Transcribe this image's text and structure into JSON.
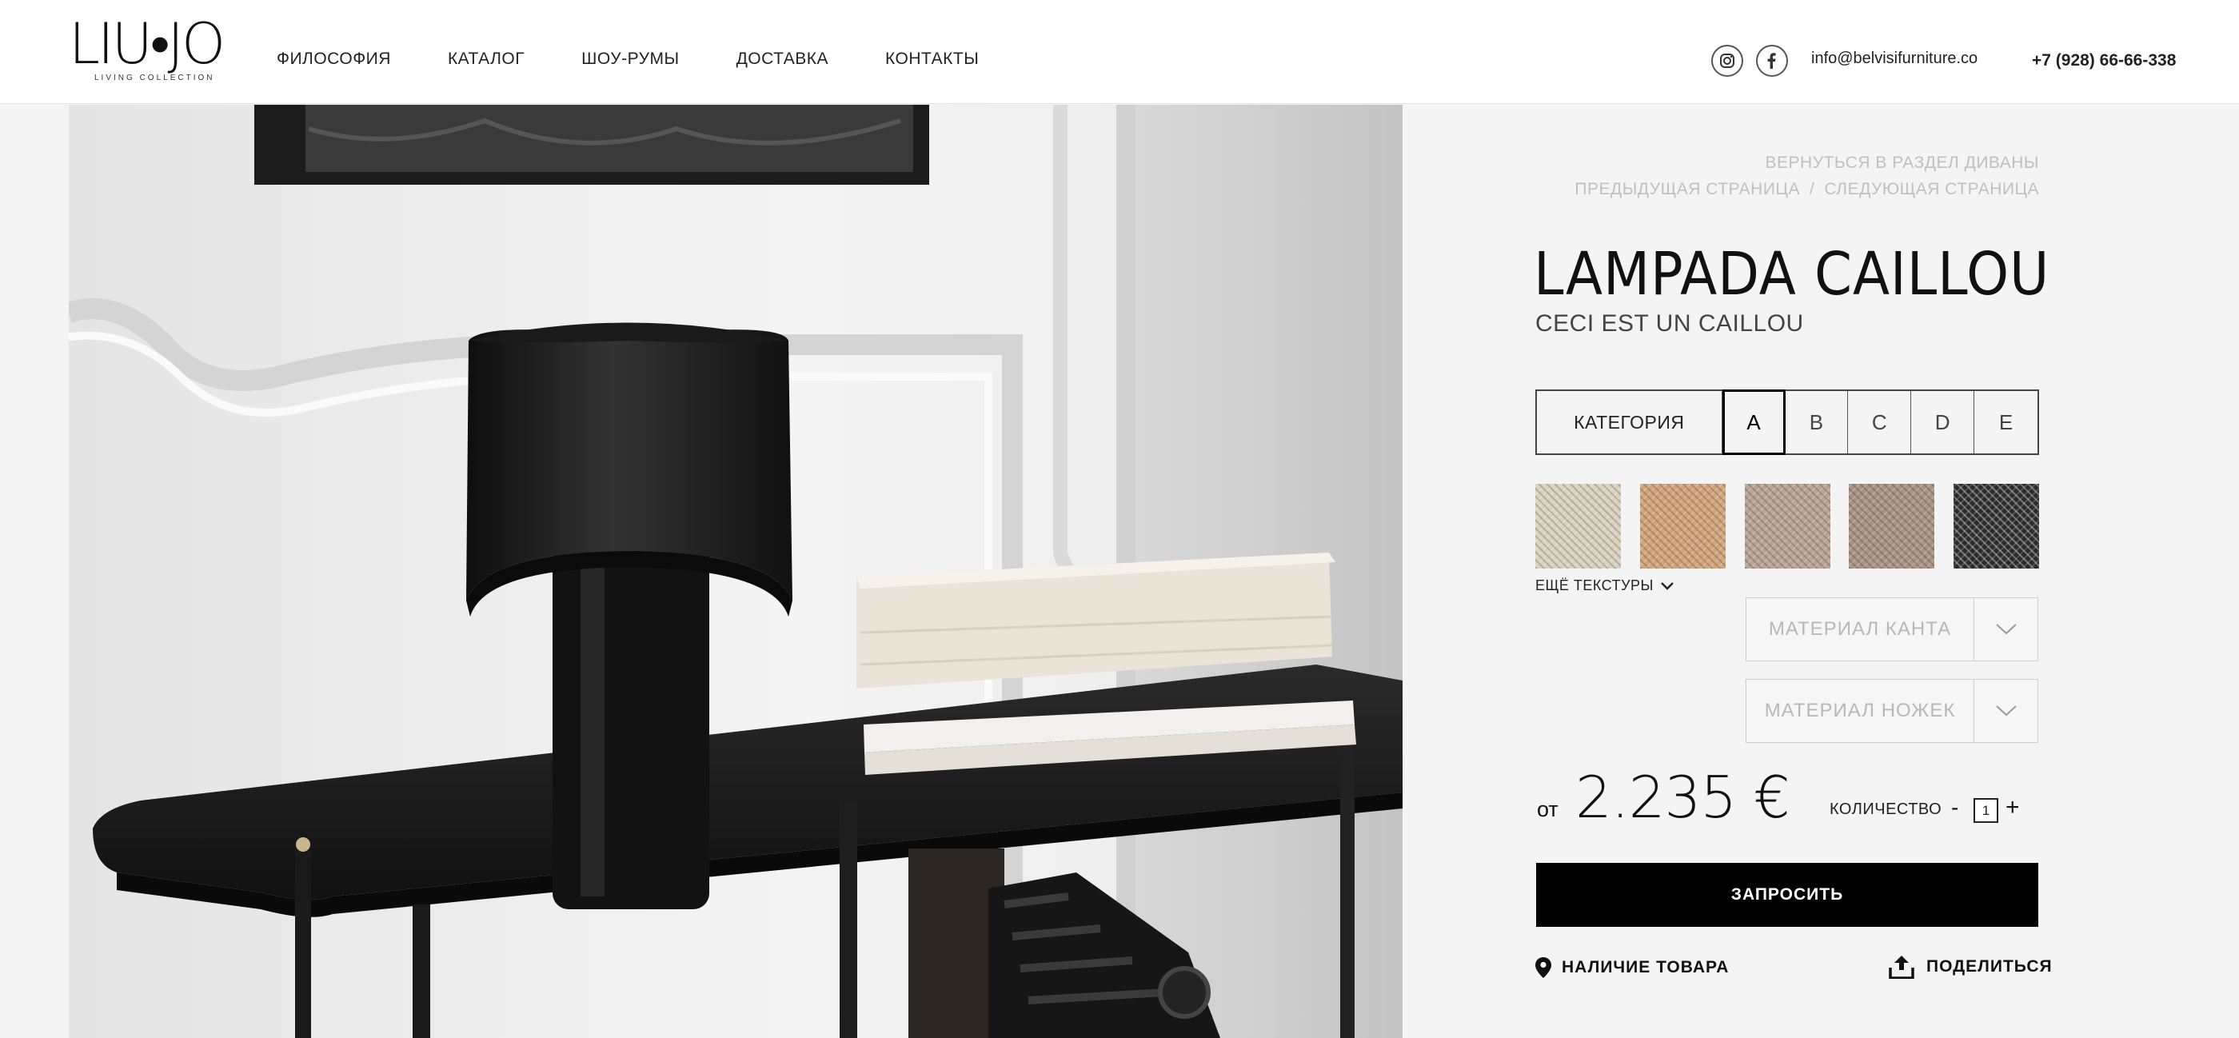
{
  "header": {
    "logo_text": "LIU•JO",
    "logo_subtitle": "LIVING COLLECTION",
    "nav": [
      {
        "label": "ФИЛОСОФИЯ"
      },
      {
        "label": "КАТАЛОГ"
      },
      {
        "label": "ШОУ-РУМЫ"
      },
      {
        "label": "ДОСТАВКА"
      },
      {
        "label": "КОНТАКТЫ"
      }
    ],
    "email": "info@belvisifurniture.co",
    "phone": "+7 (928) 66-66-338",
    "social_icons": [
      "instagram-icon",
      "facebook-icon"
    ]
  },
  "breadcrumbs": {
    "back": "ВЕРНУТЬСЯ В РАЗДЕЛ ДИВАНЫ",
    "prev": "ПРЕДЫДУЩАЯ СТРАНИЦА",
    "separator": "/",
    "next": "СЛЕДУЮЩАЯ СТРАНИЦА"
  },
  "product": {
    "title": "LAMPADA CAILLOU",
    "subtitle": "CECI EST UN CAILLOU",
    "category_label": "КАТЕГОРИЯ",
    "categories": [
      "A",
      "B",
      "C",
      "D",
      "E"
    ],
    "selected_category": "A",
    "more_textures": "ЕЩЁ ТЕКСТУРЫ",
    "swatch_colors": [
      "#d8d2bf",
      "#d2a67c",
      "#b7a594",
      "#a79482",
      "#2a2a2a"
    ],
    "dropdowns": [
      {
        "label": "МАТЕРИАЛ КАНТА"
      },
      {
        "label": "МАТЕРИАЛ НОЖЕК"
      }
    ],
    "price_prefix": "от",
    "price": "2.235 €",
    "quantity_label": "КОЛИЧЕСТВО",
    "quantity_minus": "-",
    "quantity_value": "1",
    "quantity_plus": "+",
    "request_button": "ЗАПРОСИТЬ",
    "availability": "НАЛИЧИЕ ТОВАРА",
    "share": "ПОДЕЛИТЬСЯ"
  },
  "colors": {
    "accent": "#000000",
    "muted_text": "#c0c0c0",
    "background": "#f4f4f4"
  }
}
